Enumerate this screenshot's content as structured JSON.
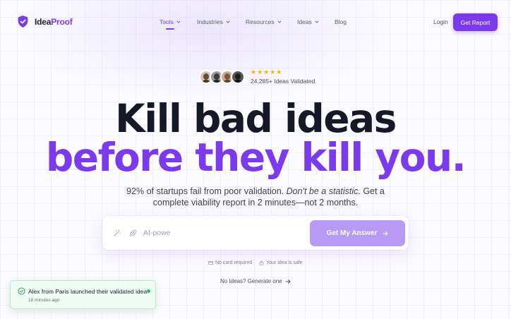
{
  "brand": {
    "prefix": "Idea",
    "accent": "Proof",
    "accent_color": "#7c3aed",
    "icon": "shield-check-icon"
  },
  "nav": {
    "items": [
      {
        "label": "Tools",
        "dropdown": true,
        "active": true
      },
      {
        "label": "Industries",
        "dropdown": true
      },
      {
        "label": "Resources",
        "dropdown": true
      },
      {
        "label": "Ideas",
        "dropdown": true
      },
      {
        "label": "Blog",
        "dropdown": false
      }
    ],
    "login": "Login",
    "cta": "Get Report"
  },
  "social_proof": {
    "stars": 5,
    "count_text": "24,285+ Ideas Validated"
  },
  "hero": {
    "line1": "Kill bad ideas",
    "line2": "before they kill you.",
    "sub_part1": "92% of startups fail from poor validation. ",
    "sub_italic": "Don't be a statistic.",
    "sub_part2": " Get a",
    "sub_line2": "complete viability report in 2 minutes—not 2 months."
  },
  "search": {
    "value": "AI-powe",
    "button": "Get My Answer",
    "icons": [
      "magic-wand-icon",
      "paperclip-icon",
      "arrow-right-icon"
    ]
  },
  "notes": {
    "no_card": "No card required",
    "safe": "Your idea is safe"
  },
  "generate_link": "No Ideas? Generate one",
  "toast": {
    "message": "Alex from Paris launched their validated idea",
    "time": "18 minutes ago",
    "status_color": "#22c55e"
  }
}
